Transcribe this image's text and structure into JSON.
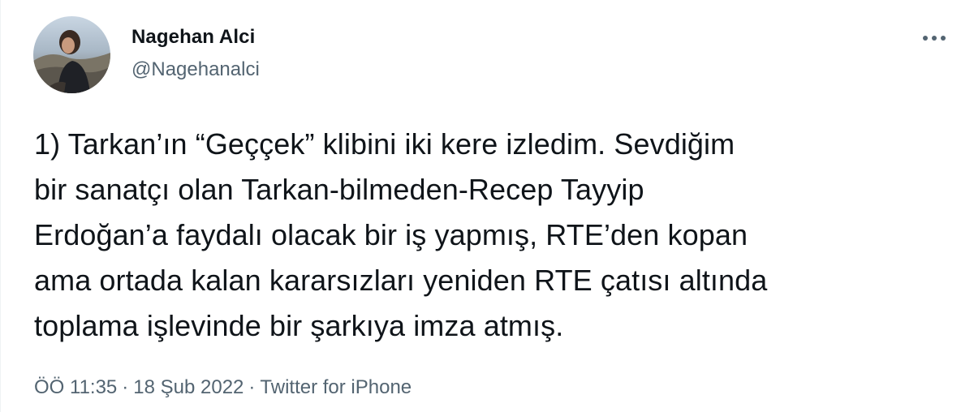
{
  "author": {
    "display_name": "Nagehan Alci",
    "handle": "@Nagehanalci",
    "avatar_icon": "profile-photo"
  },
  "more_icon": "more-horizontal-icon",
  "tweet": {
    "lines": [
      "1) Tarkan’ın “Geççek” klibini iki kere izledim. Sevdiğim",
      "bir sanatçı olan Tarkan-bilmeden-Recep Tayyip",
      "Erdoğan’a faydalı olacak bir iş yapmış, RTE’den kopan",
      "ama ortada kalan kararsızları yeniden RTE çatısı altında",
      "toplama işlevinde bir şarkıya imza atmış."
    ]
  },
  "meta": {
    "time": "ÖÖ 11:35",
    "separator": "·",
    "date": "18 Şub 2022",
    "source": "Twitter for iPhone"
  },
  "colors": {
    "text": "#0f1419",
    "secondary": "#536471",
    "background": "#ffffff"
  }
}
